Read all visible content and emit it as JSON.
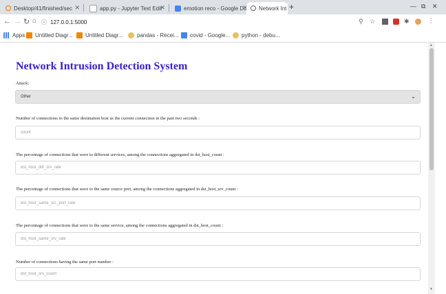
{
  "browser": {
    "tabs": [
      {
        "title": "Desktop/41/finished/sec",
        "fav_color": "#e37400"
      },
      {
        "title": "app.py - Jupyter Text Edit",
        "fav_color": "#9aa0a6"
      },
      {
        "title": "emotion reco - Google Do",
        "fav_color": "#4285f4"
      },
      {
        "title": "Network Intrusion Detecti",
        "fav_color": "#5f6368"
      }
    ],
    "new_tab_glyph": "+",
    "url": "127.0.0.1:5000",
    "bookmarks": [
      {
        "label": "Apps",
        "icon": "apps-grid-icon",
        "color": "#4285f4"
      },
      {
        "label": "Untitled Diagr...",
        "icon": "drawio-icon",
        "color": "#f08705"
      },
      {
        "label": "Untitled Diagr...",
        "icon": "drawio-icon",
        "color": "#f08705"
      },
      {
        "label": "pandas - Recei...",
        "icon": "pandas-icon",
        "color": "#e8c15b"
      },
      {
        "label": "covid - Google...",
        "icon": "docs-icon",
        "color": "#4285f4"
      },
      {
        "label": "python - debu...",
        "icon": "python-icon",
        "color": "#e8c15b"
      }
    ]
  },
  "page": {
    "title": "Network Intrusion Detection System",
    "attack_label": "Attack:",
    "attack_value": "Other",
    "fields": [
      {
        "label": "Number of connections to the same destination host as the current connection in the past two seconds :",
        "placeholder": "count"
      },
      {
        "label": "The percentage of connections that were to different services, among the connections aggregated in dst_host_count :",
        "placeholder": "dst_host_diff_srv_rate"
      },
      {
        "label": "The percentage of connections that were to the same source port, among the connections aggregated in dst_host_srv_count :",
        "placeholder": "dst_host_same_src_port_rate"
      },
      {
        "label": "The percentage of connections that were to the same service, among the connections aggregated in dst_host_count :",
        "placeholder": "dst_host_same_srv_rate"
      },
      {
        "label": "Number of connections having the same port number :",
        "placeholder": "dst_host_srv_count"
      }
    ]
  },
  "colors": {
    "title": "#3b21c8",
    "select_bg": "#e4e4e4"
  }
}
